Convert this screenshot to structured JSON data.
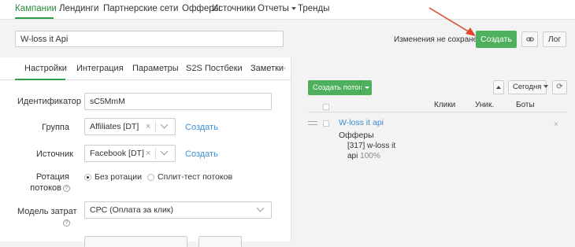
{
  "topnav": {
    "items": [
      "Кампании",
      "Лендинги",
      "Партнерские сети",
      "Офферы",
      "Источники",
      "Отчеты",
      "Тренды"
    ],
    "active_index": 0
  },
  "campaign": {
    "name": "W-loss it Api",
    "unsaved_text": "Изменения не сохранены",
    "create_label": "Создать",
    "link_icon": "link-icon",
    "log_label": "Лог"
  },
  "tabs": [
    "Настройки",
    "Интеграция",
    "Параметры",
    "S2S Постбеки",
    "Заметки"
  ],
  "settings": {
    "identifier_label": "Идентификатор",
    "identifier_value": "sC5MmM",
    "group_label": "Группа",
    "group_value": "Affiliates [DT]",
    "group_create": "Создать",
    "source_label": "Источник",
    "source_value": "Facebook [DT]",
    "source_create": "Создать",
    "rotation_label_1": "Ротация",
    "rotation_label_2": "потоков",
    "rotation_options": [
      "Без ротации",
      "Сплит-тест потоков"
    ],
    "rotation_selected": 0,
    "cost_label": "Модель затрат",
    "cost_value": "CPC (Оплата за клик)"
  },
  "flows": {
    "create_flow_label": "Создать поток",
    "date_label": "Сегодня",
    "columns": [
      "Клики",
      "Уник.",
      "Боты"
    ],
    "items": [
      {
        "name": "W-loss it api",
        "offers_title": "Офферы",
        "offer_line_1": "[317] w-loss it",
        "offer_line_2": "api",
        "offer_share": "100%"
      }
    ]
  },
  "colors": {
    "accent_green": "#4eb05c",
    "link_blue": "#3a8fd6",
    "arrow_red": "#e0442b"
  }
}
